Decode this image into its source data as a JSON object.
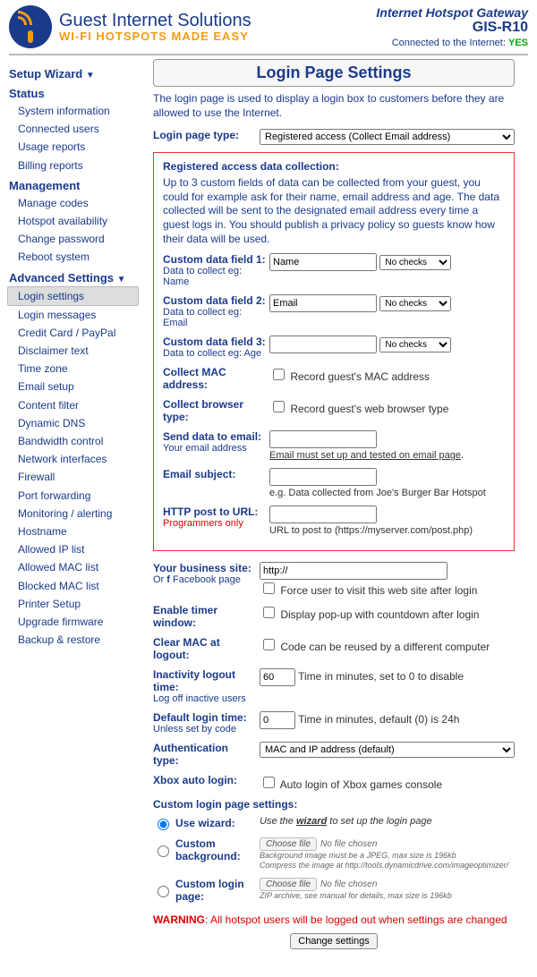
{
  "header": {
    "brand_line1": "Guest Internet Solutions",
    "brand_line2": "WI-FI HOTSPOTS MADE EASY",
    "product_line1": "Internet Hotspot Gateway",
    "product_line2": "GIS-R10",
    "conn_label": "Connected to the Internet: ",
    "conn_status": "YES"
  },
  "sidebar": {
    "setup_wizard": "Setup Wizard",
    "status_head": "Status",
    "status_items": [
      "System information",
      "Connected users",
      "Usage reports",
      "Billing reports"
    ],
    "mgmt_head": "Management",
    "mgmt_items": [
      "Manage codes",
      "Hotspot availability",
      "Change password",
      "Reboot system"
    ],
    "adv_head": "Advanced Settings",
    "adv_items": [
      "Login settings",
      "Login messages",
      "Credit Card / PayPal",
      "Disclaimer text",
      "Time zone",
      "Email setup",
      "Content filter",
      "Dynamic DNS",
      "Bandwidth control",
      "Network interfaces",
      "Firewall",
      "Port forwarding",
      "Monitoring / alerting",
      "Hostname",
      "Allowed IP list",
      "Allowed MAC list",
      "Blocked MAC list",
      "Printer Setup",
      "Upgrade firmware",
      "Backup & restore"
    ]
  },
  "page": {
    "title": "Login Page Settings",
    "intro": "The login page is used to display a login box to customers before they are allowed to use the Internet.",
    "login_type_label": "Login page type:",
    "login_type_value": "Registered access (Collect Email address)",
    "reg": {
      "title": "Registered access data collection:",
      "desc": "Up to 3 custom fields of data can be collected from your guest, you could for example ask for their name, email address and age. The data collected will be sent to the designated email address every time a guest logs in. You should publish a privacy policy so guests know how their data will be used.",
      "f1_label": "Custom data field 1:",
      "f1_sub": "Data to collect eg: Name",
      "f1_value": "Name",
      "f1_check": "No checks",
      "f2_label": "Custom data field 2:",
      "f2_sub": "Data to collect eg: Email",
      "f2_value": "Email",
      "f2_check": "No checks",
      "f3_label": "Custom data field 3:",
      "f3_sub": "Data to collect eg: Age",
      "f3_value": "",
      "f3_check": "No checks",
      "mac_label": "Collect MAC address:",
      "mac_hint": "Record guest's MAC address",
      "browser_label": "Collect browser type:",
      "browser_hint": "Record guest's web browser type",
      "email_label": "Send data to email:",
      "email_sub": "Your email address",
      "email_hint": "Email must set up and tested on email page",
      "subj_label": "Email subject:",
      "subj_hint": "e.g. Data collected from Joe's Burger Bar Hotspot",
      "post_label": "HTTP post to URL:",
      "post_sub": "Programmers only",
      "post_hint": "URL to post to (https://myserver.com/post.php)"
    },
    "biz_label": "Your business site:",
    "biz_sub_pre": "Or ",
    "biz_sub_post": " Facebook page",
    "biz_value": "http://",
    "biz_force": "Force user to visit this web site after login",
    "timer_label": "Enable timer window:",
    "timer_hint": "Display pop-up with countdown after login",
    "clearmac_label": "Clear MAC at logout:",
    "clearmac_hint": "Code can be reused by a different computer",
    "inact_label": "Inactivity logout time:",
    "inact_sub": "Log off inactive users",
    "inact_value": "60",
    "inact_hint": "Time in minutes, set to 0 to disable",
    "dft_label": "Default login time:",
    "dft_sub": "Unless set by code",
    "dft_value": "0",
    "dft_hint": "Time in minutes, default (0) is 24h",
    "auth_label": "Authentication type:",
    "auth_value": "MAC and IP address (default)",
    "xbox_label": "Xbox auto login:",
    "xbox_hint": "Auto login of Xbox games console",
    "custom_title": "Custom login page settings:",
    "wiz_label": "Use wizard:",
    "wiz_hint_pre": "Use the ",
    "wiz_hint_bold": "wizard",
    "wiz_hint_post": " to set up the login page",
    "bg_label": "Custom background:",
    "file_choose": "Choose file",
    "file_none": "No file chosen",
    "bg_note1": "Background image must be a JPEG, max size is 196kb",
    "bg_note2": "Compress the image at http://tools.dynamicdrive.com/imageoptimizer/",
    "cl_label": "Custom login page:",
    "cl_note": "ZIP archive, see manual for details, max size is 196kb",
    "warning_b": "WARNING",
    "warning_t": ": All hotspot users will be logged out when settings are changed",
    "submit": "Change settings"
  }
}
